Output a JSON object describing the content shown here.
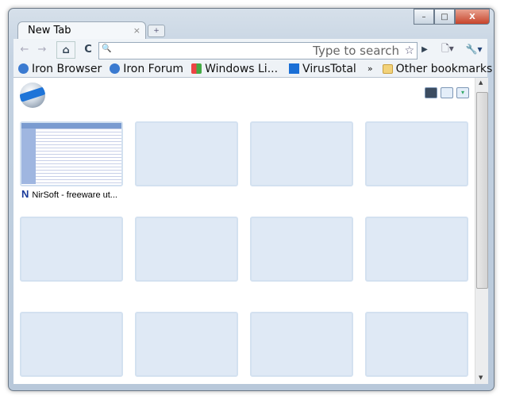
{
  "window": {
    "minimize": "–",
    "maximize": "□",
    "close": "X"
  },
  "tab": {
    "title": "New Tab",
    "close": "×",
    "new_tab": "+"
  },
  "toolbar": {
    "back": "←",
    "forward": "→",
    "home": "⌂",
    "reload": "C",
    "search_icon": "🔍",
    "omnibox_placeholder": "Type to search",
    "star": "☆",
    "go": "▶",
    "page_menu": "🗋▾",
    "wrench_menu": "🔧▾"
  },
  "bookmarks": {
    "items": [
      {
        "label": "Iron Browser",
        "icon": "iron-icon"
      },
      {
        "label": "Iron Forum",
        "icon": "iron-icon"
      },
      {
        "label": "Windows Li...",
        "icon": "windows-icon"
      },
      {
        "label": "VirusTotal",
        "icon": "virustotal-icon"
      }
    ],
    "overflow": "»",
    "other": "Other bookmarks"
  },
  "newtab": {
    "view_buttons": [
      "thumbnail-view",
      "list-view",
      "menu"
    ],
    "thumbnails": [
      {
        "title": "NirSoft - freeware ut...",
        "icon": "N"
      }
    ]
  }
}
